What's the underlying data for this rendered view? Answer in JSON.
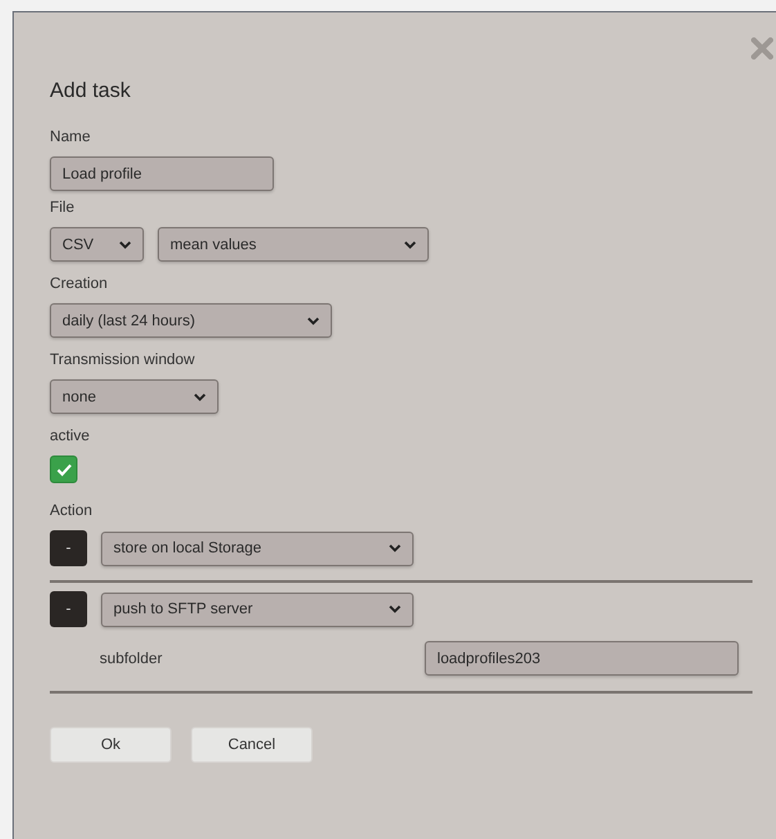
{
  "dialog": {
    "title": "Add task"
  },
  "name": {
    "label": "Name",
    "value": "Load profile"
  },
  "file": {
    "label": "File",
    "format": "CSV",
    "content": "mean values"
  },
  "creation": {
    "label": "Creation",
    "value": "daily (last 24 hours)"
  },
  "transmission_window": {
    "label": "Transmission window",
    "value": "none"
  },
  "active": {
    "label": "active",
    "checked": true
  },
  "action": {
    "label": "Action",
    "items": [
      {
        "remove": "-",
        "value": "store on local Storage"
      },
      {
        "remove": "-",
        "value": "push to SFTP server",
        "subfolder": {
          "label": "subfolder",
          "value": "loadprofiles203"
        }
      }
    ]
  },
  "buttons": [
    "Ok",
    "Cancel"
  ]
}
